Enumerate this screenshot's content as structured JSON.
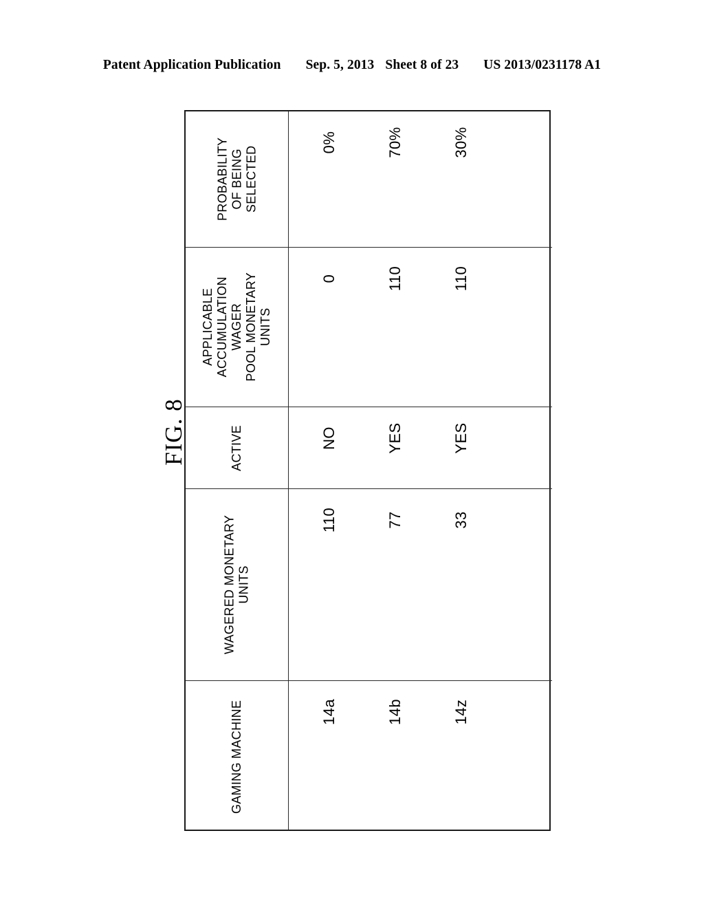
{
  "header": {
    "publication": "Patent Application Publication",
    "date": "Sep. 5, 2013",
    "sheet": "Sheet 8 of 23",
    "patent_number": "US 2013/0231178 A1"
  },
  "figure": {
    "label": "FIG. 8"
  },
  "table": {
    "row_header_label": "GAMING MACHINE",
    "machines": [
      "14a",
      "14b",
      "14z"
    ],
    "columns": [
      {
        "name": "probability-of-being-selected",
        "header_lines": [
          "PROBABILITY",
          "OF BEING",
          "SELECTED"
        ],
        "values": [
          "0%",
          "70%",
          "30%"
        ]
      },
      {
        "name": "applicable-accumulation-wager-pool-monetary-units",
        "header_lines": [
          "APPLICABLE",
          "ACCUMULATION",
          "WAGER",
          "POOL MONETARY",
          "UNITS"
        ],
        "values": [
          "0",
          "110",
          "110"
        ]
      },
      {
        "name": "active",
        "header_lines": [
          "ACTIVE"
        ],
        "values": [
          "NO",
          "YES",
          "YES"
        ]
      },
      {
        "name": "wagered-monetary-units",
        "header_lines": [
          "WAGERED MONETARY",
          "UNITS"
        ],
        "values": [
          "110",
          "77",
          "33"
        ]
      },
      {
        "name": "gaming-machine",
        "header_lines": [
          "GAMING MACHINE"
        ],
        "values": [
          "14a",
          "14b",
          "14z"
        ]
      }
    ]
  }
}
